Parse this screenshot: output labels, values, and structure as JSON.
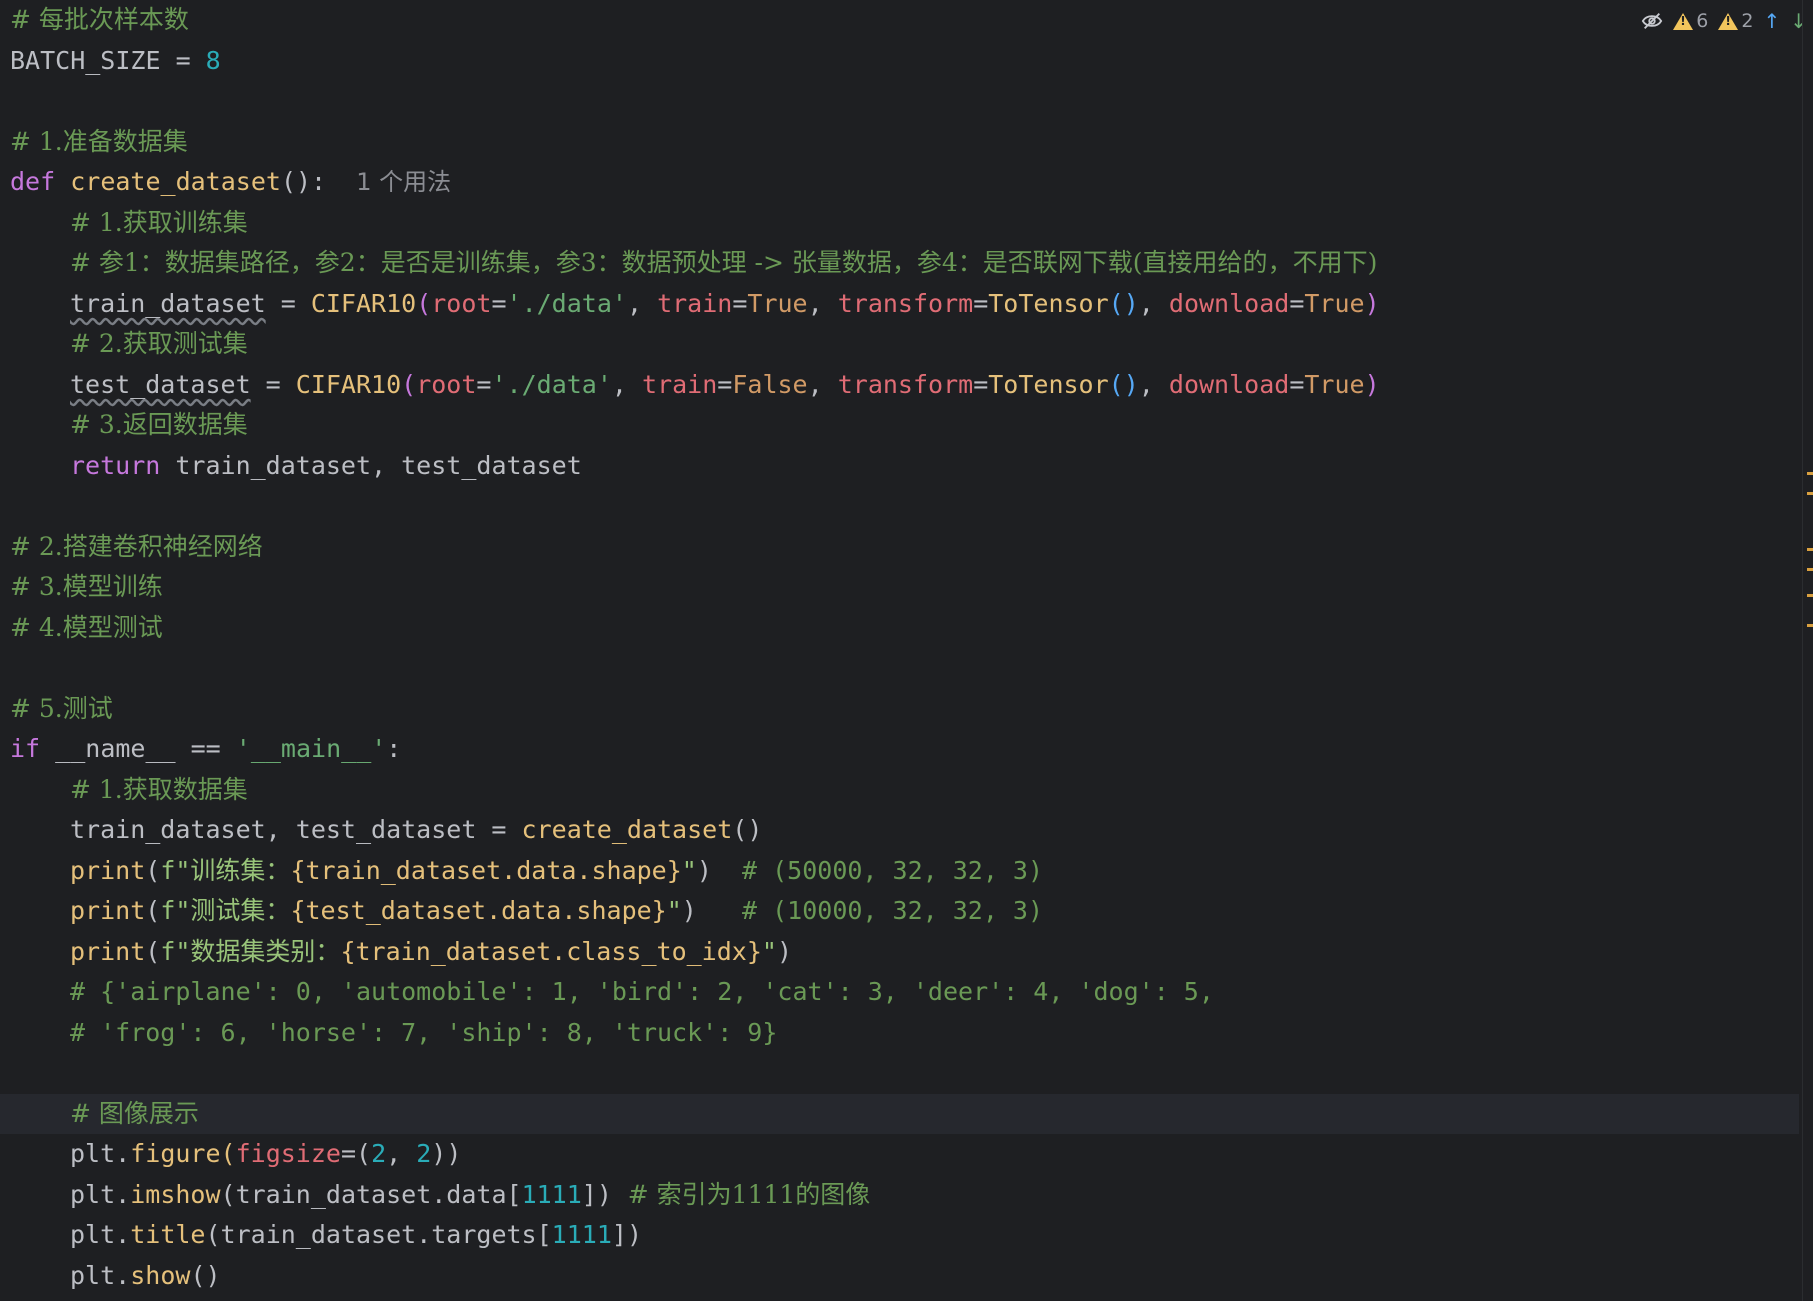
{
  "status": {
    "warnings_a": "6",
    "warnings_b": "2",
    "icons": [
      "eye-off-icon",
      "warning-icon",
      "warning-icon",
      "arrow-up-icon",
      "arrow-down-icon"
    ],
    "colors": {
      "warning": "#f2c55c",
      "background": "#1e1f22",
      "comment": "#6a9955"
    }
  },
  "code": {
    "l1": "# 每批次样本数",
    "l2_name": "BATCH_SIZE",
    "l2_eq": " = ",
    "l2_val": "8",
    "l4": "# 1.准备数据集",
    "l5_def": "def",
    "l5_fn": "create_dataset",
    "l5_sig": "():",
    "l5_hint": "1 个用法",
    "l6": "# 1.获取训练集",
    "l7": "# 参1：数据集路径，参2：是否是训练集，参3：数据预处理 -> 张量数据，参4：是否联网下载(直接用给的，不用下)",
    "l8_var": "train_dataset",
    "l8_eq": " = ",
    "l8_cls": "CIFAR10",
    "l8_open": "(",
    "l8_p1": "root",
    "l8_eq1": "=",
    "l8_s1": "'./data'",
    "l8_c1": ", ",
    "l8_p2": "train",
    "l8_eq2": "=",
    "l8_b2": "True",
    "l8_c2": ", ",
    "l8_p3": "transform",
    "l8_eq3": "=",
    "l8_f3": "ToTensor",
    "l8_pp3": "()",
    "l8_c3": ", ",
    "l8_p4": "download",
    "l8_eq4": "=",
    "l8_b4": "True",
    "l8_close": ")",
    "l9": "# 2.获取测试集",
    "l10_var": "test_dataset",
    "l10_b2": "False",
    "l11": "# 3.返回数据集",
    "l12_kw": "return",
    "l12_rest": " train_dataset, test_dataset",
    "l14": "# 2.搭建卷积神经网络",
    "l15": "# 3.模型训练",
    "l16": "# 4.模型测试",
    "l18": "# 5.测试",
    "l19_kw": "if",
    "l19_rest": " __name__ == ",
    "l19_str": "'__main__'",
    "l19_colon": ":",
    "l20": "# 1.获取数据集",
    "l21_a": "train_dataset, test_dataset = ",
    "l21_fn": "create_dataset",
    "l21_b": "()",
    "l22_fn": "print",
    "l22_open": "(",
    "l22_f": "f\"训练集：",
    "l22_expr": "{train_dataset.data.shape}",
    "l22_q": "\"",
    "l22_close": ")",
    "l22_cm": "  # (50000, 32, 32, 3)",
    "l23_f": "f\"测试集：",
    "l23_expr": "{test_dataset.data.shape}",
    "l23_cm": "   # (10000, 32, 32, 3)",
    "l24_f": "f\"数据集类别：",
    "l24_expr": "{train_dataset.class_to_idx}",
    "l25": "# {'airplane': 0, 'automobile': 1, 'bird': 2, 'cat': 3, 'deer': 4, 'dog': 5,",
    "l26": "# 'frog': 6, 'horse': 7, 'ship': 8, 'truck': 9}",
    "l28": "# 图像展示",
    "l29_a": "plt.",
    "l29_fn": "figure",
    "l29_open": "(",
    "l29_p": "figsize",
    "l29_eq": "=(",
    "l29_n1": "2",
    "l29_c": ", ",
    "l29_n2": "2",
    "l29_close": "))",
    "l30_a": "plt.",
    "l30_fn": "imshow",
    "l30_b": "(train_dataset.data[",
    "l30_n": "1111",
    "l30_c": "])",
    "l30_cm": "  # 索引为1111的图像",
    "l31_a": "plt.",
    "l31_fn": "title",
    "l31_b": "(train_dataset.targets[",
    "l31_n": "1111",
    "l31_c": "])",
    "l32_a": "plt.",
    "l32_fn": "show",
    "l32_b": "()"
  }
}
